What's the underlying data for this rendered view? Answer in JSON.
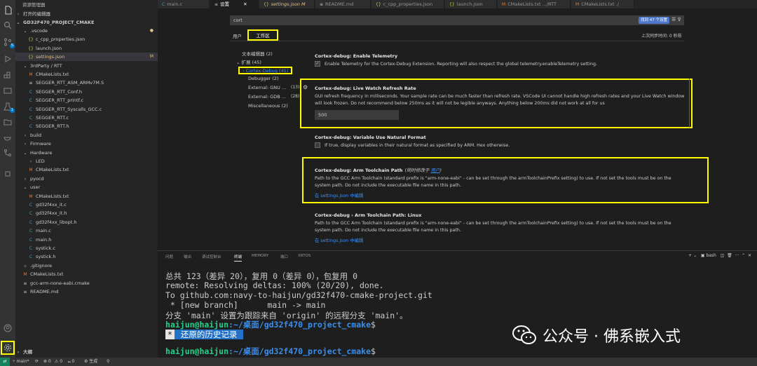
{
  "sidebar": {
    "title": "资源管理器",
    "open_editors": "打开的编辑器",
    "project": "GD32F470_PROJECT_CMAKE",
    "outline": "大纲",
    "items": [
      {
        "label": ".vscode",
        "icon": "chevron-down",
        "tag": "●"
      },
      {
        "label": "c_cpp_properties.json",
        "icon": "{}"
      },
      {
        "label": "launch.json",
        "icon": "{}"
      },
      {
        "label": "settings.json",
        "icon": "{}",
        "tag": "M"
      },
      {
        "label": "3rdParty / RTT",
        "icon": "chevron-down"
      },
      {
        "label": "CMakeLists.txt",
        "icon": "M"
      },
      {
        "label": "SEGGER_RTT_ASM_ARMv7M.S",
        "icon": "≡"
      },
      {
        "label": "SEGGER_RTT_Conf.h",
        "icon": "C"
      },
      {
        "label": "SEGGER_RTT_printf.c",
        "icon": "C"
      },
      {
        "label": "SEGGER_RTT_Syscalls_GCC.c",
        "icon": "C"
      },
      {
        "label": "SEGGER_RTT.c",
        "icon": "C"
      },
      {
        "label": "SEGGER_RTT.h",
        "icon": "C"
      },
      {
        "label": "build",
        "icon": "chevron-right"
      },
      {
        "label": "Firmware",
        "icon": "chevron-right"
      },
      {
        "label": "Hardware",
        "icon": "chevron-down"
      },
      {
        "label": "LED",
        "icon": "chevron-right"
      },
      {
        "label": "CMakeLists.txt",
        "icon": "M"
      },
      {
        "label": "pyocd",
        "icon": "chevron-right"
      },
      {
        "label": "user",
        "icon": "chevron-down"
      },
      {
        "label": "CMakeLists.txt",
        "icon": "M"
      },
      {
        "label": "gd32f4xx_it.c",
        "icon": "C"
      },
      {
        "label": "gd32f4xx_it.h",
        "icon": "C"
      },
      {
        "label": "gd32f4xx_libopt.h",
        "icon": "C"
      },
      {
        "label": "main.c",
        "icon": "C"
      },
      {
        "label": "main.h",
        "icon": "C"
      },
      {
        "label": "systick.c",
        "icon": "C"
      },
      {
        "label": "systick.h",
        "icon": "C"
      },
      {
        "label": ".gitignore",
        "icon": "◆"
      },
      {
        "label": "CMakeLists.txt",
        "icon": "M"
      },
      {
        "label": "gcc-arm-none-eabi.cmake",
        "icon": "≡"
      },
      {
        "label": "README.md",
        "icon": "≡"
      }
    ]
  },
  "tabs": [
    {
      "label": "main.c",
      "icon": "C"
    },
    {
      "label": "设置",
      "icon": "≡",
      "active": true
    },
    {
      "label": "settings.json M",
      "icon": "{}"
    },
    {
      "label": "README.md",
      "icon": "≡"
    },
    {
      "label": "c_cpp_properties.json",
      "icon": "{}"
    },
    {
      "label": "launch.json",
      "icon": "{}"
    },
    {
      "label": "CMakeLists.txt .../RTT",
      "icon": "M"
    },
    {
      "label": "CMakeLists.txt ./",
      "icon": "M"
    }
  ],
  "settings": {
    "search_value": "cort",
    "found": "找到 47 个设置",
    "scope_user": "用户",
    "scope_workspace": "工作区",
    "last_synced": "上次同步时间: 0 秒前",
    "toc": {
      "text_editor": "文本编辑器 (2)",
      "extensions": "扩展 (45)",
      "cortex_debug": "Cortex-Debug (45)",
      "debugger": "Debugger (2)",
      "external_gnu": "External: GNU ...",
      "external_gnu_count": "(13)",
      "external_gdb": "External: GDB ...",
      "external_gdb_count": "(28)",
      "misc": "Miscellaneous (2)"
    },
    "items": {
      "telemetry": {
        "category": "Cortex-debug: ",
        "name": "Enable Telemetry",
        "desc": "Enable Telemetry for the Cortex-Debug Extension. Reporting will also respect the global telemetry.enableTelemetry setting."
      },
      "live_watch": {
        "category": "Cortex-debug: ",
        "name": "Live Watch Refresh Rate",
        "desc": "GUI refresh frequency in milliseconds. Your sample rate can be much faster than refresh rate. VSCode UI cannot handle high refresh rates and your Live Watch window will look frozen. Do not recommend below 250ms as it will not be legible anyways. Anything below 200ms did not work at all for us",
        "value": "500"
      },
      "natural_format": {
        "category": "Cortex-debug: ",
        "name": "Variable Use Natural Format",
        "desc": "If true, display variables in their natural format as specified by ARM. Hex otherwise."
      },
      "toolchain_path": {
        "category": "Cortex-debug: ",
        "name": "Arm Toolchain Path",
        "modified_prefix": "(同时修改于 ",
        "modified_link": "用户",
        "modified_suffix": ")",
        "desc": "Path to the GCC Arm Toolchain (standard prefix is \"arm-none-eabi\" - can be set through the armToolchainPrefix setting) to use. If not set the tools must be on the system path. Do not include the executable file name in this path.",
        "link": "在 settings.json 中编辑"
      },
      "toolchain_linux": {
        "category": "Cortex-debug › ",
        "name": "Arm Toolchain Path: Linux",
        "desc": "Path to the GCC Arm Toolchain (standard prefix is \"arm-none-eabi\" - can be set through the armToolchainPrefix setting) to use. If not set the tools must be on the system path. Do not include the executable file name in this path.",
        "link": "在 settings.json 中编辑"
      }
    }
  },
  "panel": {
    "tabs": [
      "问题",
      "输出",
      "调试控制台",
      "终端",
      "MEMORY",
      "端口",
      "XRTOS"
    ],
    "active_tab": "终端",
    "shell": "bash",
    "terminal": {
      "line1": "总共 123（差异 20），复用 0（差异 0），包复用 0",
      "line2": "remote: Resolving deltas: 100% (20/20), done.",
      "line3": "To github.com:navy-to-haijun/gd32f470-cmake-project.git",
      "line4": " * [new branch]      main -> main",
      "line5": "分支 'main' 设置为跟踪来自 'origin' 的远程分支 'main'。",
      "prompt_user": "haijun@haijun",
      "prompt_path": ":~/桌面/gd32f470_project_cmake",
      "prompt_end": "$",
      "history_mark": "*",
      "history_label": " 还原的历史记录 "
    }
  },
  "status": {
    "branch": "main*",
    "sync": "⟳",
    "errors": "⊗ 0",
    "warnings": "⚠ 0",
    "ports": "⑉ 0",
    "build": "⚙ 生成",
    "debug": "⚲"
  },
  "watermark": {
    "text": "公众号 · 佛系嵌入式"
  },
  "colors": {
    "highlight": "#ffff00",
    "accent": "#007acc",
    "link": "#3794ff"
  }
}
